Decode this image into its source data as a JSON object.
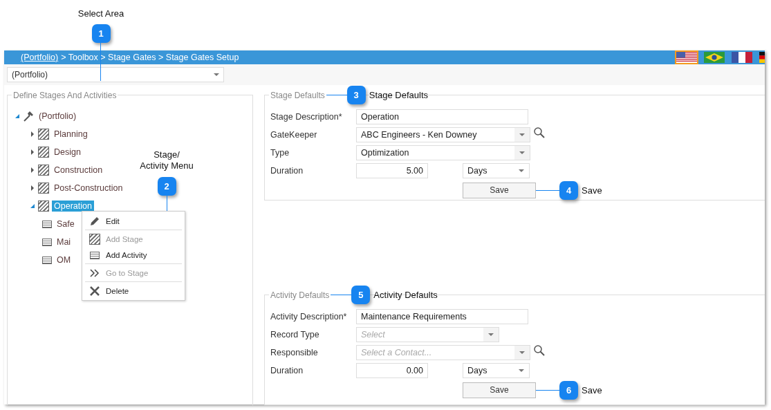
{
  "select_area": {
    "callout": {
      "number": "1",
      "label": "Select Area"
    }
  },
  "breadcrumb": {
    "link": "(Portfolio)",
    "rest": "> Toolbox > Stage Gates > Stage Gates Setup"
  },
  "languages": [
    {
      "kind": "us",
      "selected": true
    },
    {
      "kind": "br",
      "selected": false
    },
    {
      "kind": "fr",
      "selected": false
    },
    {
      "kind": "de",
      "selected": false
    }
  ],
  "area_dropdown": {
    "value": "(Portfolio)"
  },
  "tree_panel": {
    "title": "Define Stages And Activities",
    "callout": {
      "number": "2",
      "label": "Stage/\nActivity Menu"
    },
    "nodes": [
      {
        "label": "(Portfolio)",
        "kind": "root",
        "expanded": true,
        "selected": false,
        "children": [
          {
            "label": "Planning",
            "kind": "stage",
            "expanded": false,
            "selected": false
          },
          {
            "label": "Design",
            "kind": "stage",
            "expanded": false,
            "selected": false
          },
          {
            "label": "Construction",
            "kind": "stage",
            "expanded": false,
            "selected": false
          },
          {
            "label": "Post-Construction",
            "kind": "stage",
            "expanded": false,
            "selected": false
          },
          {
            "label": "Operation",
            "kind": "stage",
            "expanded": true,
            "selected": true,
            "children": [
              {
                "label": "Safe",
                "kind": "activity",
                "selected": false
              },
              {
                "label": "Mai",
                "kind": "activity",
                "selected": false
              },
              {
                "label": "OM",
                "kind": "activity",
                "selected": false
              }
            ]
          }
        ]
      }
    ]
  },
  "context_menu": {
    "items": [
      {
        "label": "Edit",
        "kind": "edit",
        "disabled": false,
        "separator_above": false
      },
      {
        "label": "Add Stage",
        "kind": "stage",
        "disabled": true,
        "separator_above": true
      },
      {
        "label": "Add Activity",
        "kind": "activity",
        "disabled": false,
        "separator_above": false
      },
      {
        "label": "Go to Stage",
        "kind": "goto",
        "disabled": true,
        "separator_above": true
      },
      {
        "label": "Delete",
        "kind": "delete",
        "disabled": false,
        "separator_above": true
      }
    ]
  },
  "stage_defaults": {
    "title": "Stage Defaults",
    "callout": {
      "number": "3",
      "label": "Stage Defaults"
    },
    "fields": [
      {
        "label": "Stage Description*",
        "kind": "text",
        "value": "Operation"
      },
      {
        "label": "GateKeeper",
        "kind": "select",
        "value": "ABC Engineers - Ken Downey",
        "lookup": true
      },
      {
        "label": "Type",
        "kind": "select",
        "value": "Optimization",
        "lookup": false
      },
      {
        "label": "Duration",
        "kind": "duration",
        "value": "5.00",
        "unit": "Days"
      }
    ],
    "save": {
      "label": "Save",
      "callout": {
        "number": "4",
        "label": "Save"
      }
    }
  },
  "activity_defaults": {
    "title": "Activity Defaults",
    "callout": {
      "number": "5",
      "label": "Activity Defaults"
    },
    "fields": [
      {
        "label": "Activity Description*",
        "kind": "text",
        "value": "Maintenance Requirements"
      },
      {
        "label": "Record Type",
        "kind": "combo",
        "placeholder": "Select",
        "lookup": false
      },
      {
        "label": "Responsible",
        "kind": "select",
        "placeholder": "Select a Contact...",
        "lookup": true
      },
      {
        "label": "Duration",
        "kind": "duration",
        "value": "0.00",
        "unit": "Days"
      }
    ],
    "save": {
      "label": "Save",
      "callout": {
        "number": "6",
        "label": "Save"
      }
    }
  }
}
